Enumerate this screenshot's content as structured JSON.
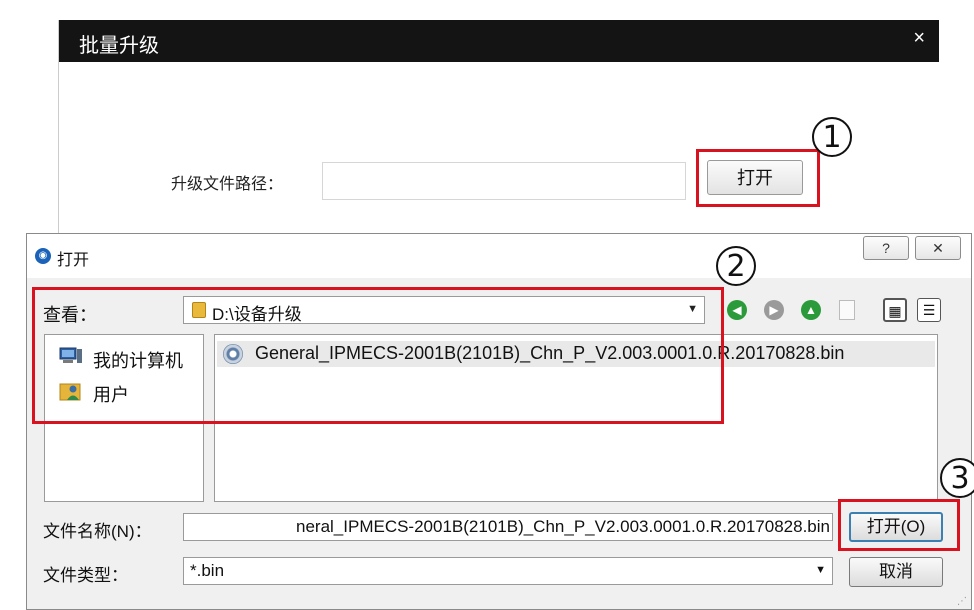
{
  "batch_window": {
    "title": "批量升级",
    "close_label": "×",
    "path_label": "升级文件路径：",
    "path_value": "",
    "open_button": "打开"
  },
  "annotations": {
    "step1": "1",
    "step2": "2",
    "step3": "3",
    "color": "#d8121e"
  },
  "dialog": {
    "title": "打开",
    "help_label": "?",
    "close_label": "✕",
    "look_in_label": "查看：",
    "look_in_value": "D:\\设备升级",
    "places": [
      {
        "label": "我的计算机",
        "icon": "computer-icon"
      },
      {
        "label": "用户",
        "icon": "user-folder-icon"
      }
    ],
    "files": [
      {
        "name": "General_IPMECS-2001B(2101B)_Chn_P_V2.003.0001.0.R.20170828.bin",
        "icon": "disc-file-icon"
      }
    ],
    "file_name_label": "文件名称(N)：",
    "file_name_value": "neral_IPMECS-2001B(2101B)_Chn_P_V2.003.0001.0.R.20170828.bin",
    "file_type_label": "文件类型：",
    "file_type_value": "*.bin",
    "open_button": "打开(O)",
    "cancel_button": "取消"
  }
}
